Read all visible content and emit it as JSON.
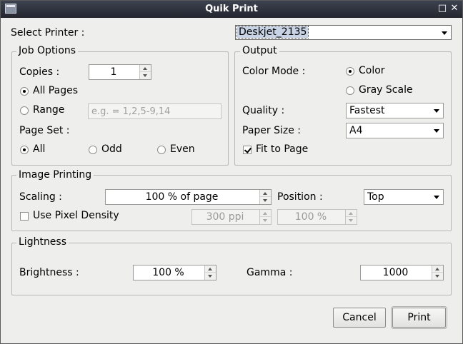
{
  "window": {
    "title": "Quik Print"
  },
  "printer": {
    "label": "Select Printer :",
    "selected": "Deskjet_2135"
  },
  "job_options": {
    "title": "Job Options",
    "copies_label": "Copies :",
    "copies_value": "1",
    "all_pages_label": "All Pages",
    "range_label": "Range",
    "range_placeholder": "e.g. = 1,2,5-9,14",
    "page_set_label": "Page Set :",
    "page_set_all": "All",
    "page_set_odd": "Odd",
    "page_set_even": "Even"
  },
  "output": {
    "title": "Output",
    "color_mode_label": "Color Mode :",
    "color_label": "Color",
    "grayscale_label": "Gray Scale",
    "quality_label": "Quality :",
    "quality_value": "Fastest",
    "paper_size_label": "Paper Size :",
    "paper_size_value": "A4",
    "fit_to_page_label": "Fit to Page"
  },
  "image_printing": {
    "title": "Image Printing",
    "scaling_label": "Scaling :",
    "scaling_value": "100 % of page",
    "position_label": "Position :",
    "position_value": "Top",
    "pixel_density_label": "Use Pixel Density",
    "ppi_value": "300 ppi",
    "percent_value": "100 %"
  },
  "lightness": {
    "title": "Lightness",
    "brightness_label": "Brightness :",
    "brightness_value": "100 %",
    "gamma_label": "Gamma :",
    "gamma_value": "1000"
  },
  "buttons": {
    "cancel": "Cancel",
    "print": "Print"
  }
}
